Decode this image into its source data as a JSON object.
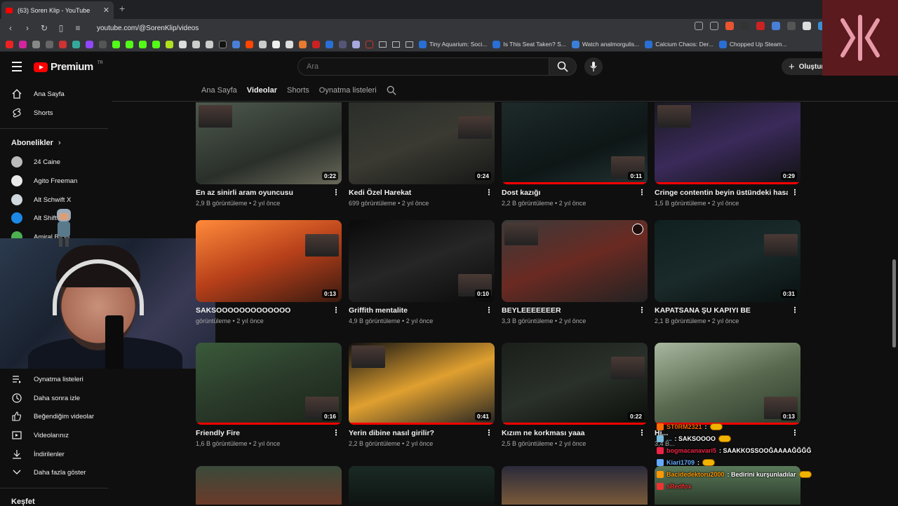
{
  "browser": {
    "tab_title": "(63) Soren Klip - YouTube",
    "url": "youtube.com/@SorenKlip/videos",
    "bookmarks_named": [
      "Tiny Aquarium: Soci...",
      "Is This Seat Taken? S...",
      "Watch analmorgulis...",
      "Calcium Chaos: Der...",
      "Chopped Up Steam..."
    ]
  },
  "header": {
    "logo_text": "Premium",
    "logo_sup": "TR",
    "search_placeholder": "Ara",
    "create_label": "Oluştur"
  },
  "channel_tabs": [
    "Ana Sayfa",
    "Videolar",
    "Shorts",
    "Oynatma listeleri"
  ],
  "sidebar": {
    "top": [
      "Ana Sayfa",
      "Shorts"
    ],
    "subscriptions_title": "Abonelikler",
    "subscriptions": [
      "24 Caine",
      "Agito Freeman",
      "Alt Schwift X",
      "Alt Shift",
      "Amiral B...lu"
    ],
    "you_items": [
      "Oynatma listeleri",
      "Daha sonra izle",
      "Beğendiğim videolar",
      "Videolarınız",
      "İndirilenler",
      "Daha fazla göster"
    ],
    "explore_title": "Keşfet"
  },
  "videos": [
    {
      "title": "En az sinirli aram oyuncusu",
      "views": "2,9 B görüntüleme",
      "age": "2 yıl önce",
      "duration": "0:22",
      "progress": 0
    },
    {
      "title": "Kedi Özel Harekat",
      "views": "699 görüntüleme",
      "age": "2 yıl önce",
      "duration": "0:24",
      "progress": 0
    },
    {
      "title": "Dost kazığı",
      "views": "2,2 B görüntüleme",
      "age": "2 yıl önce",
      "duration": "0:11",
      "progress": 1
    },
    {
      "title": "Cringe contentin beyin üstündeki hasarı",
      "views": "1,5 B görüntüleme",
      "age": "2 yıl önce",
      "duration": "0:29",
      "progress": 1
    },
    {
      "title": "SAKSOOOOOOOOOOOOO",
      "views": "görüntüleme",
      "age": "2 yıl önce",
      "duration": "0:13",
      "progress": 0
    },
    {
      "title": "Griffith mentalite",
      "views": "4,9 B görüntüleme",
      "age": "2 yıl önce",
      "duration": "0:10",
      "progress": 0
    },
    {
      "title": "BEYLEEEEEEER",
      "views": "3,3 B görüntüleme",
      "age": "2 yıl önce",
      "duration": "",
      "progress": 0
    },
    {
      "title": "KAPATSANA ŞU KAPIYI BE",
      "views": "2,1 B görüntüleme",
      "age": "2 yıl önce",
      "duration": "0:31",
      "progress": 0
    },
    {
      "title": "Friendly Fire",
      "views": "1,6 B görüntüleme",
      "age": "2 yıl önce",
      "duration": "0:16",
      "progress": 1
    },
    {
      "title": "Yerin dibine nasıl girilir?",
      "views": "2,2 B görüntüleme",
      "age": "2 yıl önce",
      "duration": "0:41",
      "progress": 1
    },
    {
      "title": "Kızım ne korkması yaaa",
      "views": "2,5 B görüntüleme",
      "age": "2 yıl önce",
      "duration": "0:22",
      "progress": 1
    },
    {
      "title": "Hi...",
      "views": "3,4 B...",
      "age": "",
      "duration": "0:13",
      "progress": 1
    }
  ],
  "chat": [
    {
      "user": "ST0RM2321",
      "msg": ":",
      "color": "#ff6a00"
    },
    {
      "user": "...",
      "msg": ": SAKSOOOO",
      "color": "#7bd"
    },
    {
      "user": "bogmacanavari5",
      "msg": ": SAAKKOSSOOĞAAAAĞĞĞĞ",
      "color": "#e24"
    },
    {
      "user": "Kiari1709",
      "msg": ":",
      "color": "#6af"
    },
    {
      "user": "Bacidedektoru2000",
      "msg": ": Bedirini kurşunladılar",
      "color": "#f90"
    },
    {
      "user": "sRedfox",
      "msg": "",
      "color": "#e33"
    }
  ]
}
